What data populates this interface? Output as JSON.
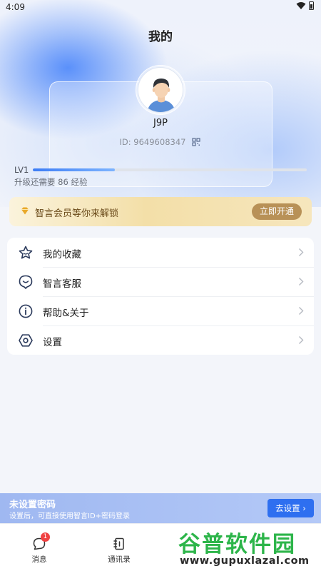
{
  "status_bar": {
    "time": "4:09"
  },
  "header": {
    "title": "我的"
  },
  "profile": {
    "username": "J9P",
    "user_id": "ID: 9649608347"
  },
  "level": {
    "label": "LV1",
    "progress_fraction": 0.3,
    "hint": "升级还需要 86 经验"
  },
  "vip": {
    "text": "智言会员等你来解锁",
    "button_label": "立即开通"
  },
  "menu": {
    "items": [
      {
        "label": "我的收藏",
        "icon": "star-icon"
      },
      {
        "label": "智言客服",
        "icon": "customer-service-icon"
      },
      {
        "label": "帮助&关于",
        "icon": "info-icon"
      },
      {
        "label": "设置",
        "icon": "settings-icon"
      }
    ]
  },
  "password_banner": {
    "title": "未设置密码",
    "description": "设置后，可直接使用智言ID+密码登录",
    "button_label": "去设置 ›"
  },
  "tabs": [
    {
      "label": "消息",
      "icon": "message-icon",
      "badge": "1"
    },
    {
      "label": "通讯录",
      "icon": "contacts-icon"
    }
  ],
  "watermark": {
    "title": "谷普软件园",
    "url": "www.gupuxlazal.com"
  },
  "colors": {
    "accent": "#2e6ff0",
    "vip_button": "#b89157",
    "badge": "#f04242"
  }
}
